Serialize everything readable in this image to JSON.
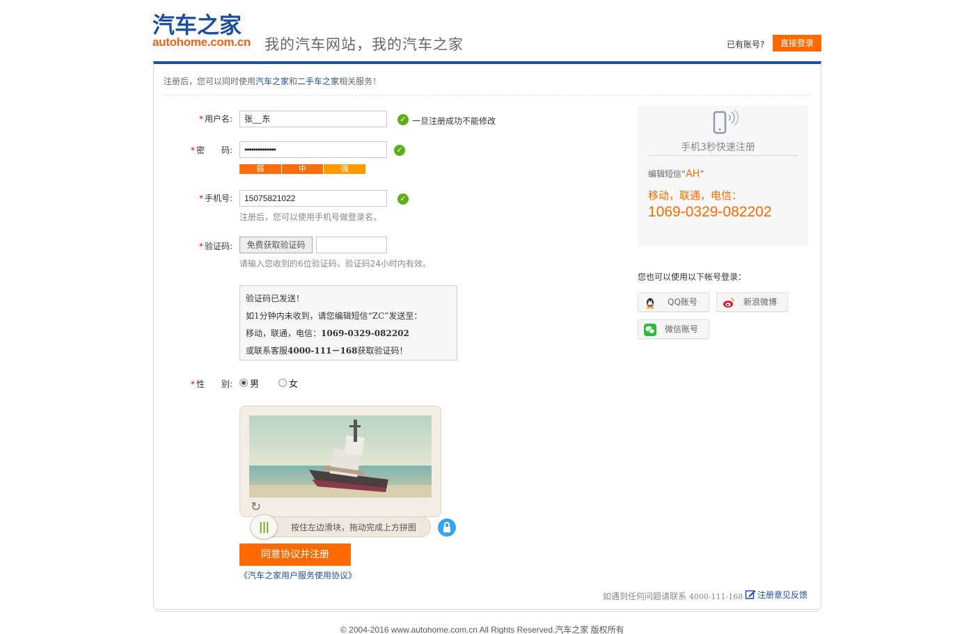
{
  "header": {
    "logo_cn": "汽车之家",
    "logo_en": "autohome.com.cn",
    "slogan": "我的汽车网站，我的汽车之家",
    "have_account": "已有账号?",
    "login_button": "直接登录"
  },
  "tip": {
    "prefix": "注册后，您可以同时使用",
    "site1": "汽车之家",
    "mid": "和",
    "site2": "二手车之家",
    "suffix": "相关服务！"
  },
  "form": {
    "username": {
      "label": "用户名:",
      "value": "张__东",
      "ok_text": "一旦注册成功不能修改"
    },
    "password": {
      "label": "密　　码:",
      "value": "••••••••••••••"
    },
    "strength": {
      "weak": "弱",
      "medium": "中",
      "strong": "强"
    },
    "phone": {
      "label": "手机号:",
      "value": "15075821022",
      "hint": "注册后，您可以使用手机号做登录名。"
    },
    "code": {
      "label": "验证码:",
      "button": "免费获取验证码",
      "value": "",
      "hint": "请输入您收到的6位验证码，验证码24小时内有效。"
    },
    "sms_notice": {
      "line1": "验证码已发送！",
      "line2": "如1分钟内未收到，请您编辑短信“ZC”发送至：",
      "line3_prefix": "移动，联通，电信：",
      "line3_number": "1069-0329-082202",
      "line4_prefix": "或联系客服",
      "line4_number": "4000-111－168",
      "line4_suffix": "获取验证码！"
    },
    "gender": {
      "label": "性　　别:",
      "male": "男",
      "female": "女",
      "selected": "男"
    },
    "captcha": {
      "slider_text": "按住左边滑块，拖动完成上方拼图"
    },
    "submit": "同意协议并注册",
    "agreement": "《汽车之家用户服务使用协议》"
  },
  "phone_register": {
    "title": "手机3秒快速注册",
    "sms_prefix": "编辑短信“",
    "sms_code": "AH",
    "sms_suffix": "”",
    "carriers": "移动，联通，电信：",
    "number": "1069-0329-082202"
  },
  "social": {
    "title": "您也可以使用以下帐号登录：",
    "qq": "QQ账号",
    "weibo": "新浪微博",
    "wechat": "微信账号"
  },
  "footer": {
    "contact_text": "如遇到任何问题请联系",
    "contact_number": "4000-111-168",
    "feedback": "注册意见反馈",
    "copyright": "© 2004-2016 www.autohome.com.cn All Rights Reserved.汽车之家 版权所有"
  },
  "colors": {
    "brand_blue": "#1d4f9e",
    "accent_orange": "#ff6a00",
    "ok_green": "#5cae1b"
  }
}
